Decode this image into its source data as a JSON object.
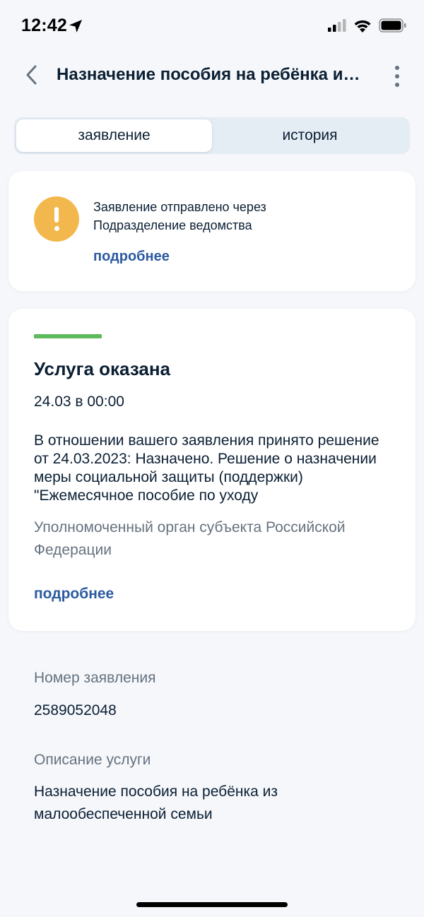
{
  "status_bar": {
    "time": "12:42"
  },
  "header": {
    "title": "Назначение пособия на ребёнка из малообеспеченной семьи"
  },
  "tabs": [
    {
      "label": "заявление",
      "active": true
    },
    {
      "label": "история",
      "active": false
    }
  ],
  "notice": {
    "line1": "Заявление отправлено через",
    "line2": "Подразделение ведомства",
    "more_label": "подробнее",
    "icon": "warning-icon",
    "icon_color": "#f3b84d"
  },
  "status_card": {
    "title": "Услуга оказана",
    "date": "24.03 в 00:00",
    "text": "В отношении вашего заявления принято решение от 24.03.2023: Назначено. Решение о назначении меры социальной защиты (поддержки) \"Ежемесячное пособие по уходу",
    "organization": "Уполномоченный орган субъекта Российской Федерации",
    "more_label": "подробнее",
    "status_color": "#5dbb5c"
  },
  "details": {
    "number_label": "Номер заявления",
    "number_value": "2589052048",
    "description_label": "Описание услуги",
    "description_value": "Назначение пособия на ребёнка из малообеспеченной семьи"
  },
  "colors": {
    "accent": "#2c5aa0",
    "text_primary": "#0b1f33",
    "text_secondary": "#66727f",
    "background": "#f5f7fb"
  }
}
